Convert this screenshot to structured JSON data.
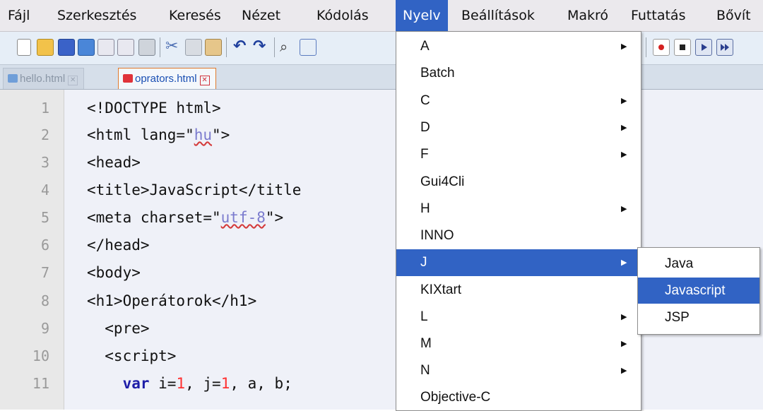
{
  "menubar": {
    "items": [
      "Fájl",
      "Szerkesztés",
      "Keresés",
      "Nézet",
      "Kódolás",
      "Nyelv",
      "Beállítások",
      "Makró",
      "Futtatás",
      "Bővít"
    ],
    "active": "Nyelv"
  },
  "toolbar": {
    "icons": [
      "new-file-icon",
      "open-folder-icon",
      "save-icon",
      "save-all-icon",
      "close-icon",
      "close-all-icon",
      "print-icon",
      "cut-icon",
      "copy-icon",
      "paste-icon",
      "undo-icon",
      "redo-icon",
      "find-icon",
      "replace-icon",
      "record-macro-icon",
      "stop-macro-icon",
      "play-macro-icon",
      "run-multiple-macro-icon"
    ]
  },
  "tabs": [
    {
      "label": "hello.html",
      "active": false
    },
    {
      "label": "oprators.html",
      "active": true
    }
  ],
  "editor": {
    "lines": [
      {
        "n": "1",
        "text": "<!DOCTYPE html>"
      },
      {
        "n": "2",
        "text": "<html lang=\"hu\">"
      },
      {
        "n": "3",
        "text": "<head>"
      },
      {
        "n": "4",
        "text": "<title>JavaScript</title"
      },
      {
        "n": "5",
        "text": "<meta charset=\"utf-8\">"
      },
      {
        "n": "6",
        "text": "</head>"
      },
      {
        "n": "7",
        "text": "<body>"
      },
      {
        "n": "8",
        "text": "<h1>Operátorok</h1>"
      },
      {
        "n": "9",
        "text": "  <pre>"
      },
      {
        "n": "10",
        "text": "  <script>"
      },
      {
        "n": "11",
        "text": "    var i=1, j=1, a, b;"
      }
    ]
  },
  "language_menu": {
    "items": [
      {
        "label": "A",
        "submenu": true
      },
      {
        "label": "Batch",
        "submenu": false
      },
      {
        "label": "C",
        "submenu": true
      },
      {
        "label": "D",
        "submenu": true
      },
      {
        "label": "F",
        "submenu": true
      },
      {
        "label": "Gui4Cli",
        "submenu": false
      },
      {
        "label": "H",
        "submenu": true
      },
      {
        "label": "INNO",
        "submenu": false
      },
      {
        "label": "J",
        "submenu": true,
        "highlighted": true
      },
      {
        "label": "KIXtart",
        "submenu": false
      },
      {
        "label": "L",
        "submenu": true
      },
      {
        "label": "M",
        "submenu": true
      },
      {
        "label": "N",
        "submenu": true
      },
      {
        "label": "Objective-C",
        "submenu": false
      }
    ],
    "j_submenu": [
      {
        "label": "Java"
      },
      {
        "label": "Javascript",
        "highlighted": true
      },
      {
        "label": "JSP"
      }
    ]
  },
  "colors": {
    "accent": "#3163c4",
    "string": "#7b7bce",
    "keyword": "#1e1ea8",
    "number": "#ff3030"
  }
}
